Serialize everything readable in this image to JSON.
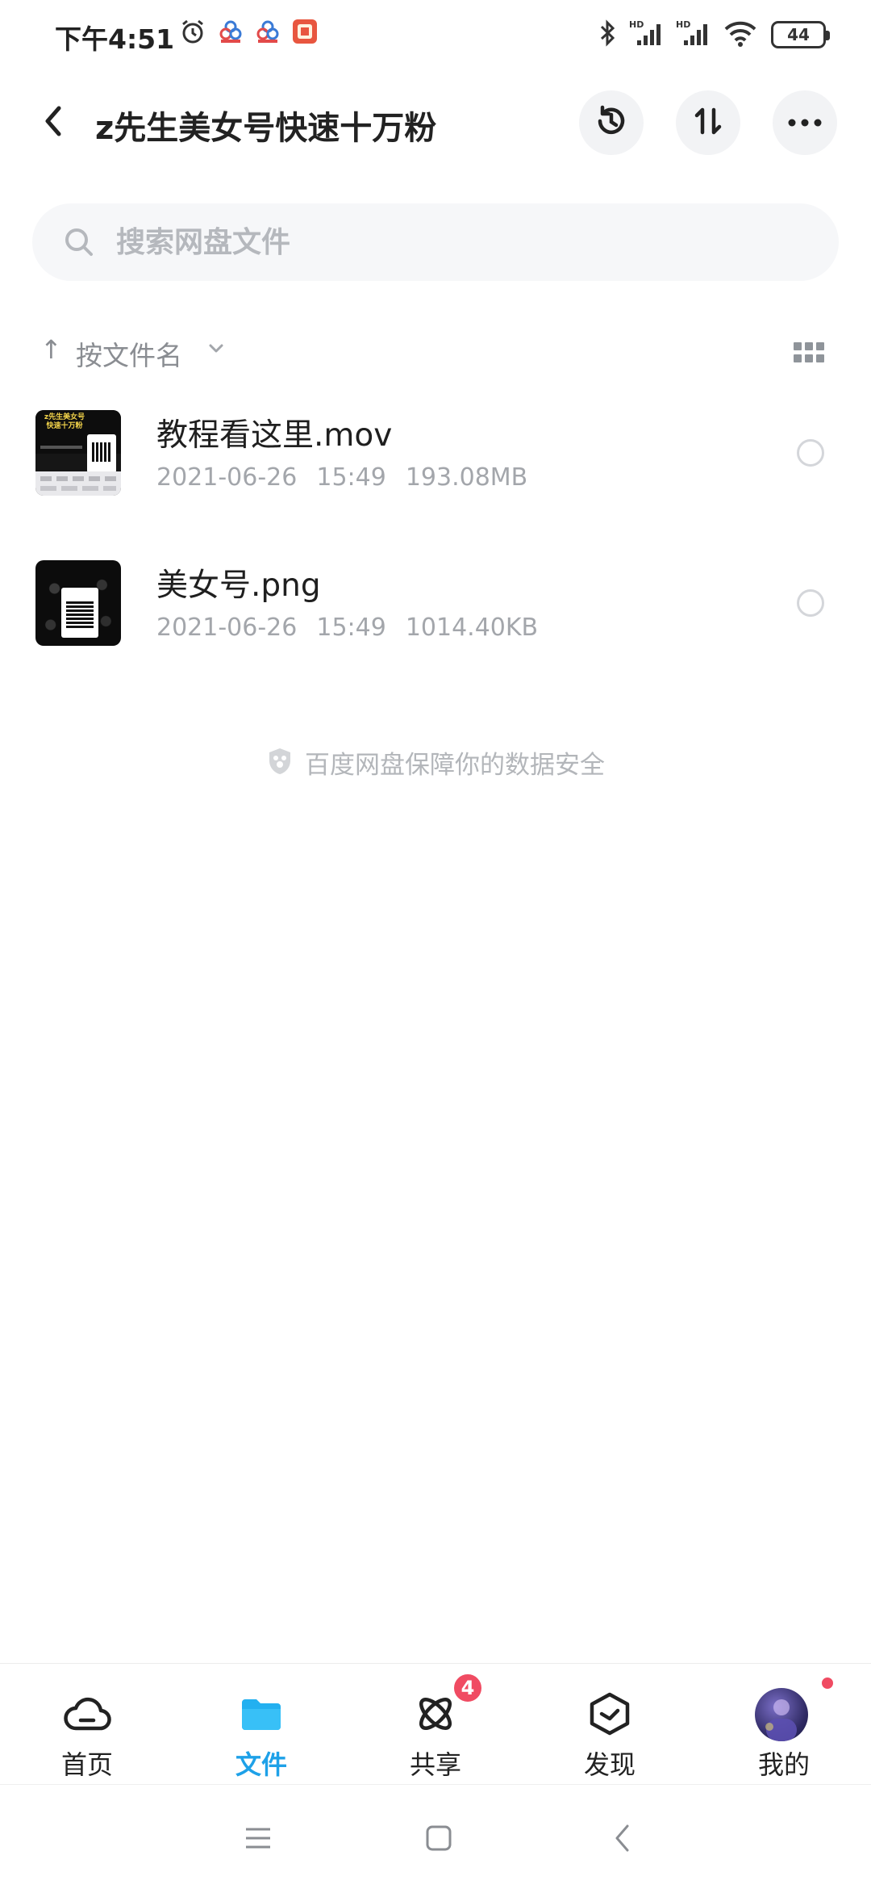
{
  "status_bar": {
    "time": "下午4:51",
    "battery": "44",
    "icons": [
      "alarm-icon",
      "app-notification-icon",
      "app-notification-icon",
      "app-notification-icon",
      "bluetooth-icon",
      "signal-hd-icon",
      "signal-hd-icon",
      "wifi-icon",
      "battery-icon"
    ],
    "signal_tags": [
      "HD",
      "HD"
    ]
  },
  "header": {
    "title": "z先生美女号快速十万粉",
    "back_icon": "chevron-left-icon",
    "actions": [
      "history-icon",
      "transfer-icon",
      "more-icon"
    ]
  },
  "search": {
    "placeholder": "搜索网盘文件"
  },
  "sort": {
    "arrow": "↑",
    "label": "按文件名"
  },
  "files": [
    {
      "name": "教程看这里.mov",
      "date": "2021-06-26",
      "time": "15:49",
      "size": "193.08MB",
      "thumb_caption": "z先生美女号 快速十万粉"
    },
    {
      "name": "美女号.png",
      "date": "2021-06-26",
      "time": "15:49",
      "size": "1014.40KB"
    }
  ],
  "security_note": "百度网盘保障你的数据安全",
  "bottom_nav": [
    {
      "label": "首页",
      "icon": "cloud-icon",
      "active": false
    },
    {
      "label": "文件",
      "icon": "folder-icon",
      "active": true
    },
    {
      "label": "共享",
      "icon": "share-orbit-icon",
      "active": false,
      "badge": "4"
    },
    {
      "label": "发现",
      "icon": "discover-icon",
      "active": false
    },
    {
      "label": "我的",
      "icon": "avatar",
      "active": false
    }
  ],
  "colors": {
    "accent": "#1ea1e8",
    "badge": "#f04b62",
    "muted_text": "#a3a6ab"
  }
}
